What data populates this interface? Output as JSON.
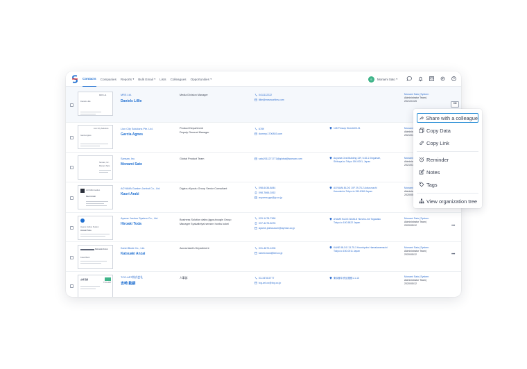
{
  "app": {
    "nav": [
      {
        "label": "Contacts",
        "active": true
      },
      {
        "label": "Companies"
      },
      {
        "label": "Reports",
        "caret": true
      },
      {
        "label": "Bulk Email",
        "caret": true
      },
      {
        "label": "Lists"
      },
      {
        "label": "Colleagues"
      },
      {
        "label": "Opportunities",
        "caret": true
      }
    ],
    "user": {
      "name": "Monami Sato",
      "initial": "S"
    },
    "caret": "▾",
    "brand_color": "#1f6fd1",
    "nav_icons": [
      "chat-icon",
      "bell-icon",
      "address-book-icon",
      "settings-icon",
      "help-icon"
    ]
  },
  "contacts": [
    {
      "company": "MRS Ltd.",
      "name": "Daniels Lillie",
      "department": "Media Division Manager",
      "department2": "",
      "phone": "0411112222",
      "phone2": "",
      "email": "lillie@mrsecurities.com",
      "address": "",
      "address2": "",
      "owner": "Monami Sato (System",
      "owner2": "Administrator Team)",
      "date": "2021/01/25",
      "card": {
        "line1": "Daniels Lillie",
        "line2": "MRS Ltd."
      }
    },
    {
      "company": "Lion City Solutions Pte. Ltd.",
      "name": "Garcia Agnes",
      "department": "Product Department",
      "department2": "Deputy General Manager",
      "phone": "6789",
      "phone2": "",
      "email": "dummy.1700803.com",
      "address": "128 Prinsep Street#03-01",
      "address2": "",
      "owner": "Monami Sato (System",
      "owner2": "Administrator Team)",
      "date": "2021/01/25",
      "card": {
        "line1": "Garcia Agnes",
        "line2": "Lion City Solutions"
      }
    },
    {
      "company": "Sansan, Inc.",
      "name": "Monami Sato",
      "department": "Global Product Team",
      "department2": "",
      "phone": "sato2011271771@global@sansan.com",
      "phone2": "",
      "email": "",
      "address": "Aoyama Oval Building 13F, 5-52-2 Jingumae,",
      "address2": "Shibuya-ku Tokyo 150-0001, Japan",
      "owner": "Monami Sato (System",
      "owner2": "Administrator Team)",
      "date": "2021/01/25",
      "card": {
        "line1": "Monami Sato",
        "line2": "Sansan, Inc."
      }
    },
    {
      "company": "AOYAMA Garden Jonbut Co., Ltd.",
      "name": "Kaori Araki",
      "department": "Digizou Kyoutu Group Senior Consultant",
      "department2": "",
      "phone": "098-6436-8844",
      "phone2": "098-7866-0262",
      "email": "aoyama-grp@jp.co.jp",
      "address": "AOYAMA BLDG 10F 29-78-2 Aoba-machi",
      "address2": "Kasumicho Tokyo-to 150-8360 Japan",
      "owner": "Monami Sato (System",
      "owner2": "Administrator Team)",
      "date": "2020/05/12",
      "card": {
        "line1": "Kaori Araki",
        "line2": "AOYAMA Garden"
      }
    },
    {
      "company": "Ayame Joshou System Co., Ltd.",
      "name": "Hiroaki Toda",
      "department": "Business Solution daibu jigyouhougin Group",
      "department2": "Manager Syakaiteiyai sensen honbu kokei",
      "phone": "029-1478-7368",
      "phone2": "097-4475-5678",
      "email": "ayame.joshousum@ayman.co.jp",
      "address": "AYAME BLDG 38-84-8 Honcho-me Togasaku",
      "address2": "Tokyo-to 100-5822 Japan",
      "owner": "Monami Sato (System",
      "owner2": "Administrator Team)",
      "date": "2020/05/12",
      "card": {
        "line1": "Hiroaki Toda",
        "line2": "Ayame Joshou System"
      }
    },
    {
      "company": "Kanei Book Co., Ltd.",
      "name": "Katsuaki Anzai",
      "department": "Accountant's Department",
      "department2": "",
      "phone": "031-4670-1206",
      "phone2": "",
      "email": "kanei-book@kbl.co.jp",
      "address": "KANEI BLDG 13-75-3 Hoonbyoho Hamakanemachi",
      "address2": "Tokyo-to 150-0011 Japan",
      "owner": "Monami Sato (System",
      "owner2": "Administrator Team)",
      "date": "2020/05/12",
      "card": {
        "line1": "Katsuaki Anzai",
        "line2": "Kanei Book"
      }
    },
    {
      "company": "TCG-ART株式会社",
      "name": "吉崎 勤嗣",
      "department": "人事部",
      "department2": "",
      "phone": "03-3478-5777",
      "phone2": "",
      "email": "tcg-art-co@tcg.co.jp",
      "address": "東京都中央区銀座1-1-13",
      "address2": "",
      "owner": "Monami Sato (System",
      "owner2": "Administrator Team)",
      "date": "2020/05/12",
      "card": {
        "line1": "吉崎 勤嗣",
        "line2": "TCG-ART"
      }
    }
  ],
  "row_more": "•••",
  "menu": {
    "items": [
      {
        "label": "Share with a colleague",
        "icon": "share-icon"
      },
      {
        "label": "Copy Data",
        "icon": "copy-data-icon"
      },
      {
        "label": "Copy Link",
        "icon": "link-icon"
      },
      {
        "label": "Reminder",
        "icon": "alarm-clock-icon"
      },
      {
        "label": "Notes",
        "icon": "notes-icon"
      },
      {
        "label": "Tags",
        "icon": "tag-icon"
      },
      {
        "label": "View organization tree",
        "icon": "org-tree-icon"
      }
    ]
  }
}
